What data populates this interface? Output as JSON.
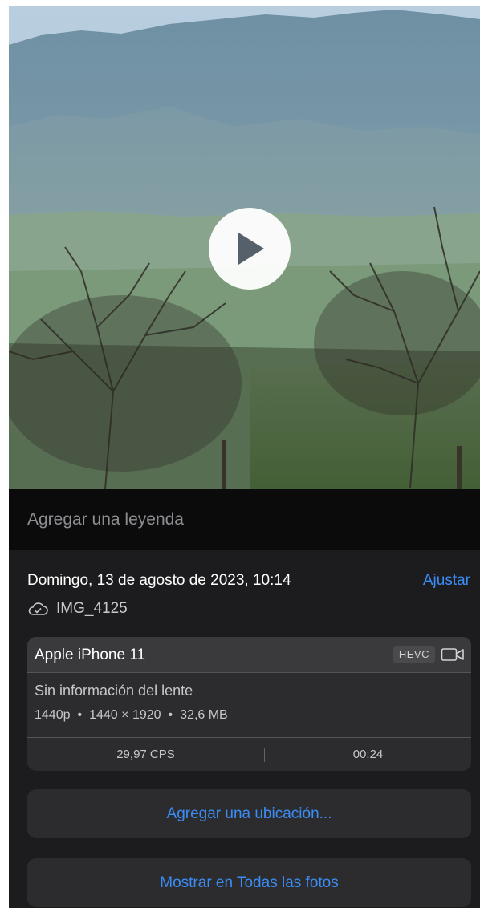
{
  "media": {
    "play_label": "Play video"
  },
  "caption": {
    "placeholder": "Agregar una leyenda"
  },
  "info": {
    "date": "Domingo, 13 de agosto de 2023, 10:14",
    "adjust_label": "Ajustar",
    "filename": "IMG_4125",
    "cloud_icon": "cloud-check-icon"
  },
  "device": {
    "name": "Apple iPhone 11",
    "codec_badge": "HEVC",
    "camera_icon": "video-camera-icon",
    "lens": "Sin información del lente",
    "resolution": "1440p",
    "dimensions": "1440 × 1920",
    "size": "32,6 MB",
    "separator": "•",
    "fps": "29,97 CPS",
    "duration": "00:24"
  },
  "actions": {
    "add_location": "Agregar una ubicación...",
    "show_in_all_photos": "Mostrar en Todas las fotos"
  },
  "colors": {
    "accent": "#3b8df6",
    "panel_bg": "#1c1c1e",
    "card_bg": "#2c2c2e",
    "caption_bg": "#0b0b0c"
  }
}
